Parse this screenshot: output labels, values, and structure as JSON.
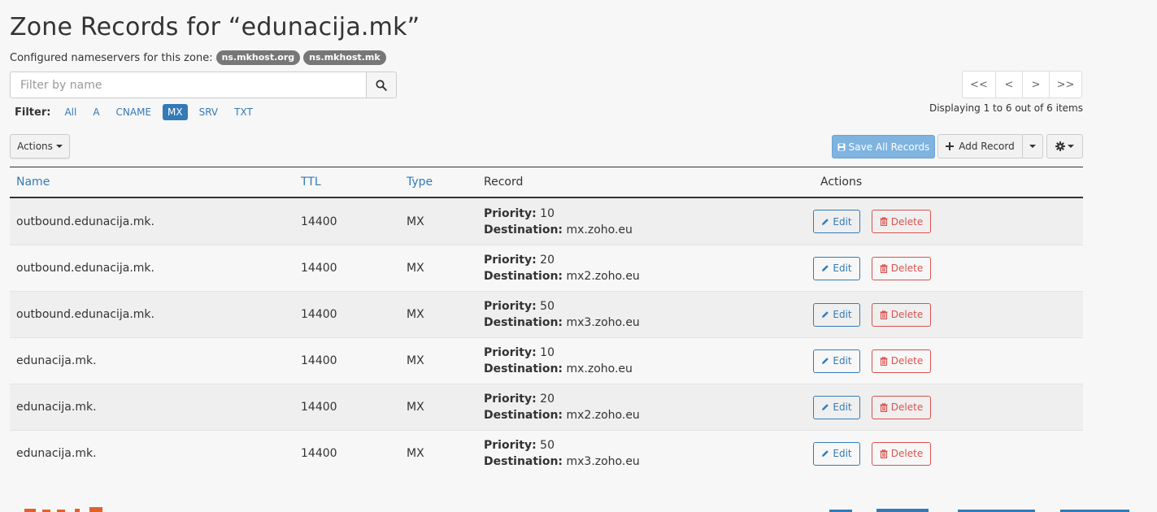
{
  "page": {
    "title": "Zone Records for “edunacija.mk”",
    "nameservers_label": "Configured nameservers for this zone:",
    "nameservers": [
      "ns.mkhost.org",
      "ns.mkhost.mk"
    ]
  },
  "search": {
    "placeholder": "Filter by name",
    "value": ""
  },
  "filter": {
    "label": "Filter:",
    "options": [
      "All",
      "A",
      "CNAME",
      "MX",
      "SRV",
      "TXT"
    ],
    "active": "MX"
  },
  "pager": {
    "buttons": [
      "<<",
      "<",
      ">",
      ">>"
    ],
    "info": "Displaying 1 to 6 out of 6 items"
  },
  "toolbar": {
    "actions_label": "Actions",
    "save_label": "Save All Records",
    "add_label": "Add Record"
  },
  "table": {
    "headers": {
      "name": "Name",
      "ttl": "TTL",
      "type": "Type",
      "record": "Record",
      "actions": "Actions"
    },
    "priority_label": "Priority:",
    "destination_label": "Destination:",
    "edit_label": "Edit",
    "delete_label": "Delete",
    "rows": [
      {
        "name": "outbound.edunacija.mk.",
        "ttl": "14400",
        "type": "MX",
        "priority": "10",
        "destination": "mx.zoho.eu"
      },
      {
        "name": "outbound.edunacija.mk.",
        "ttl": "14400",
        "type": "MX",
        "priority": "20",
        "destination": "mx2.zoho.eu"
      },
      {
        "name": "outbound.edunacija.mk.",
        "ttl": "14400",
        "type": "MX",
        "priority": "50",
        "destination": "mx3.zoho.eu"
      },
      {
        "name": "edunacija.mk.",
        "ttl": "14400",
        "type": "MX",
        "priority": "10",
        "destination": "mx.zoho.eu"
      },
      {
        "name": "edunacija.mk.",
        "ttl": "14400",
        "type": "MX",
        "priority": "20",
        "destination": "mx2.zoho.eu"
      },
      {
        "name": "edunacija.mk.",
        "ttl": "14400",
        "type": "MX",
        "priority": "50",
        "destination": "mx3.zoho.eu"
      }
    ]
  },
  "colors": {
    "link": "#337ab7",
    "danger": "#d9534f",
    "badge": "#777777",
    "save_button": "#7fb3e0",
    "brand": "#e2602b"
  },
  "icons": {
    "search": "search-icon",
    "save": "floppy-icon",
    "add": "plus-icon",
    "gear": "gear-icon",
    "edit": "pencil-icon",
    "delete": "trash-icon"
  }
}
